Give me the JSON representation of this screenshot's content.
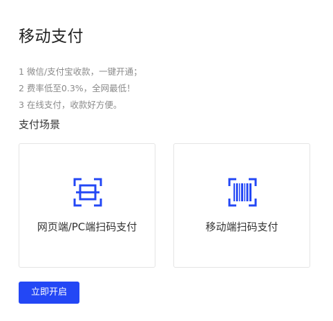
{
  "page": {
    "title": "移动支付"
  },
  "description": {
    "lines": [
      "1 微信/支付宝收款，一键开通；",
      "2 费率低至0.3%，全网最低！",
      "3 在线支付，收款好方便。"
    ]
  },
  "scenes": {
    "title": "支付场景",
    "cards": [
      {
        "label": "网页端/PC端扫码支付",
        "icon": "qr-scan-icon"
      },
      {
        "label": "移动端扫码支付",
        "icon": "barcode-scan-icon"
      }
    ]
  },
  "actions": {
    "open_label": "立即开启"
  },
  "colors": {
    "accent": "#2347f5",
    "text_primary": "#222222",
    "text_secondary": "#8a8a8a",
    "border": "#e4e4e4"
  }
}
